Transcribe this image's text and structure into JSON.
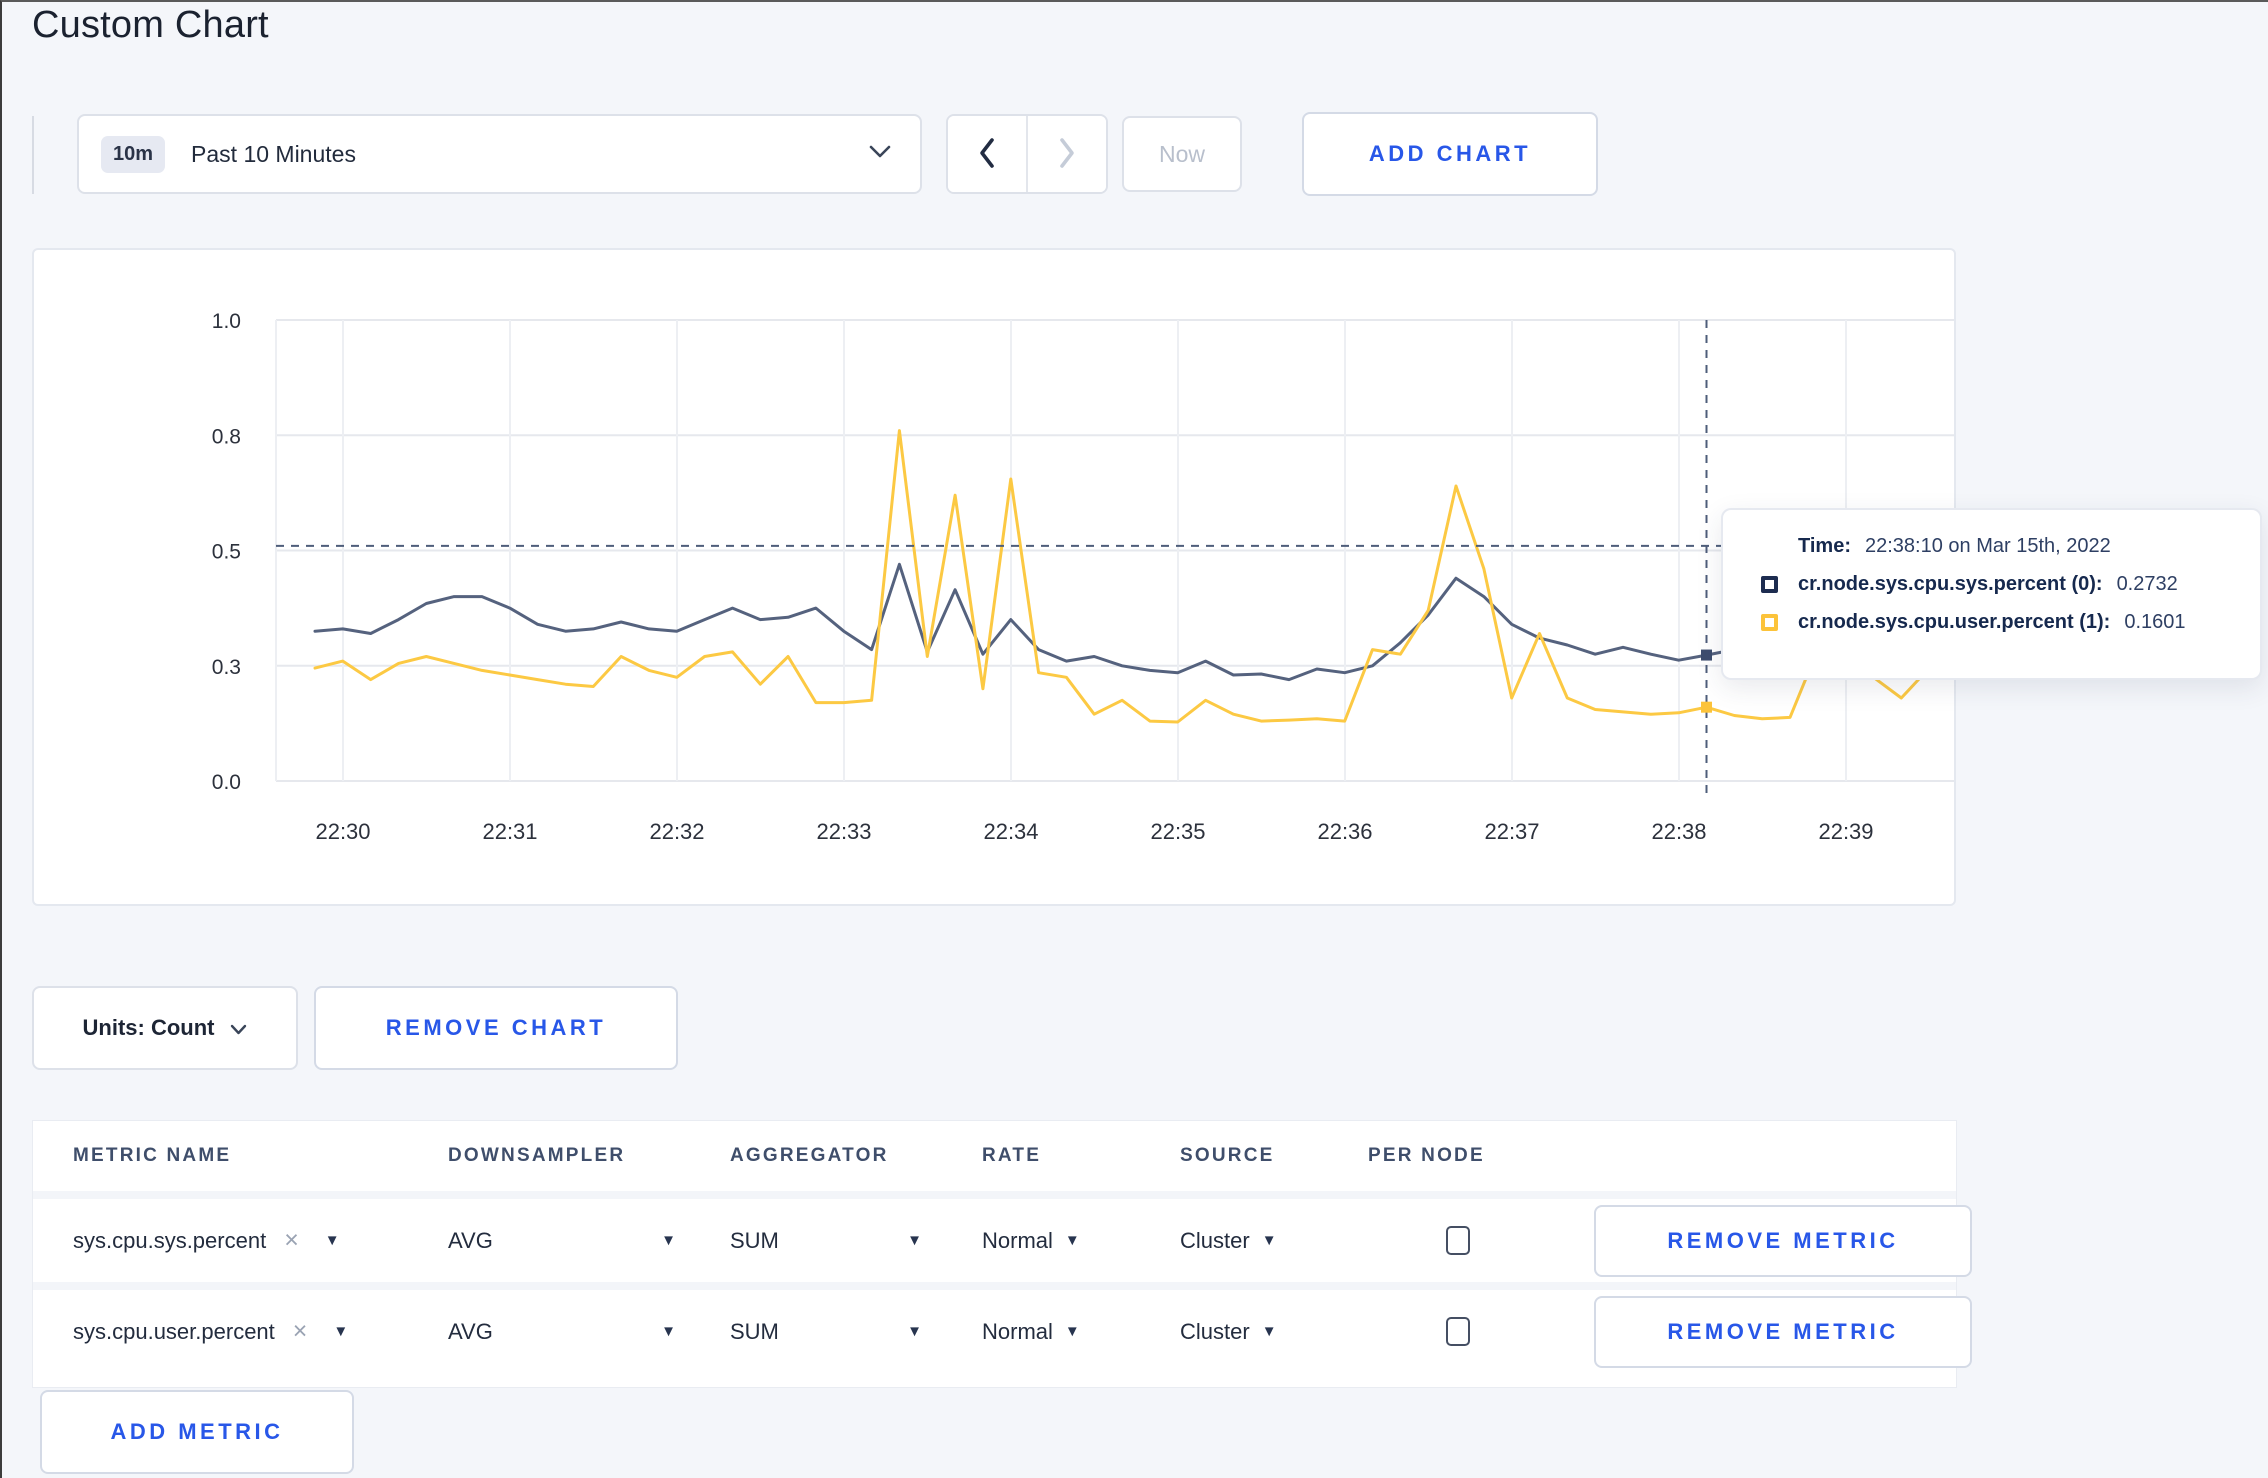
{
  "title": "Custom Chart",
  "toolbar": {
    "range_badge": "10m",
    "range_label": "Past 10 Minutes",
    "now_label": "Now",
    "add_chart_label": "ADD CHART"
  },
  "controls": {
    "units_label": "Units: Count",
    "remove_chart_label": "REMOVE CHART"
  },
  "tooltip": {
    "time_label": "Time:",
    "time_value": "22:38:10 on Mar 15th, 2022",
    "series": [
      {
        "label": "cr.node.sys.cpu.sys.percent (0):",
        "value": "0.2732",
        "color": "#1d2c50"
      },
      {
        "label": "cr.node.sys.cpu.user.percent (1):",
        "value": "0.1601",
        "color": "#fcc33a"
      }
    ]
  },
  "chart_data": {
    "type": "line",
    "title": "",
    "xlabel": "",
    "ylabel": "",
    "ylim": [
      0,
      1
    ],
    "grid": true,
    "x_tick_labels": [
      "22:30",
      "22:31",
      "22:32",
      "22:33",
      "22:34",
      "22:35",
      "22:36",
      "22:37",
      "22:38",
      "22:39"
    ],
    "y_ticks": [
      {
        "value": 0,
        "label": "0.0"
      },
      {
        "value": 0.25,
        "label": "0.3"
      },
      {
        "value": 0.5,
        "label": "0.5"
      },
      {
        "value": 0.75,
        "label": "0.8"
      },
      {
        "value": 1.0,
        "label": "1.0"
      }
    ],
    "times": [
      "22:29:50",
      "22:30:00",
      "22:30:10",
      "22:30:20",
      "22:30:30",
      "22:30:40",
      "22:30:50",
      "22:31:00",
      "22:31:10",
      "22:31:20",
      "22:31:30",
      "22:31:40",
      "22:31:50",
      "22:32:00",
      "22:32:10",
      "22:32:20",
      "22:32:30",
      "22:32:40",
      "22:32:50",
      "22:33:00",
      "22:33:10",
      "22:33:20",
      "22:33:30",
      "22:33:40",
      "22:33:50",
      "22:34:00",
      "22:34:10",
      "22:34:20",
      "22:34:30",
      "22:34:40",
      "22:34:50",
      "22:35:00",
      "22:35:10",
      "22:35:20",
      "22:35:30",
      "22:35:40",
      "22:35:50",
      "22:36:00",
      "22:36:10",
      "22:36:20",
      "22:36:30",
      "22:36:40",
      "22:36:50",
      "22:37:00",
      "22:37:10",
      "22:37:20",
      "22:37:30",
      "22:37:40",
      "22:37:50",
      "22:38:00",
      "22:38:10",
      "22:38:20",
      "22:38:30",
      "22:38:40",
      "22:38:50",
      "22:39:00",
      "22:39:10",
      "22:39:20",
      "22:39:30"
    ],
    "series": [
      {
        "name": "cr.node.sys.cpu.sys.percent (0)",
        "color": "#55627e",
        "values": [
          0.325,
          0.33,
          0.32,
          0.35,
          0.385,
          0.4,
          0.4,
          0.375,
          0.34,
          0.325,
          0.33,
          0.345,
          0.33,
          0.325,
          0.35,
          0.375,
          0.35,
          0.355,
          0.375,
          0.325,
          0.285,
          0.47,
          0.28,
          0.415,
          0.275,
          0.35,
          0.285,
          0.26,
          0.27,
          0.25,
          0.24,
          0.235,
          0.26,
          0.23,
          0.232,
          0.22,
          0.243,
          0.235,
          0.25,
          0.3,
          0.36,
          0.44,
          0.4,
          0.34,
          0.31,
          0.295,
          0.275,
          0.29,
          0.275,
          0.262,
          0.2732,
          0.285,
          0.275,
          0.28,
          0.3,
          0.285,
          0.28,
          0.285,
          0.29
        ]
      },
      {
        "name": "cr.node.sys.cpu.user.percent (1)",
        "color": "#fcc943",
        "values": [
          0.245,
          0.26,
          0.22,
          0.255,
          0.27,
          0.255,
          0.24,
          0.23,
          0.22,
          0.21,
          0.205,
          0.27,
          0.24,
          0.225,
          0.27,
          0.28,
          0.21,
          0.27,
          0.17,
          0.17,
          0.175,
          0.76,
          0.27,
          0.62,
          0.2,
          0.655,
          0.235,
          0.225,
          0.145,
          0.175,
          0.13,
          0.128,
          0.175,
          0.145,
          0.13,
          0.132,
          0.135,
          0.13,
          0.285,
          0.275,
          0.37,
          0.64,
          0.46,
          0.18,
          0.32,
          0.18,
          0.155,
          0.15,
          0.145,
          0.148,
          0.1601,
          0.142,
          0.135,
          0.138,
          0.285,
          0.28,
          0.225,
          0.18,
          0.245
        ]
      }
    ],
    "crosshair": {
      "time": "22:38:10",
      "index": 50,
      "h_line_value": 0.51
    }
  },
  "metrics_table": {
    "headers": [
      "METRIC NAME",
      "DOWNSAMPLER",
      "AGGREGATOR",
      "RATE",
      "SOURCE",
      "PER NODE"
    ],
    "rows": [
      {
        "metric_name": "sys.cpu.sys.percent",
        "downsampler": "AVG",
        "aggregator": "SUM",
        "rate": "Normal",
        "source": "Cluster",
        "per_node_checked": false,
        "remove_label": "REMOVE METRIC"
      },
      {
        "metric_name": "sys.cpu.user.percent",
        "downsampler": "AVG",
        "aggregator": "SUM",
        "rate": "Normal",
        "source": "Cluster",
        "per_node_checked": false,
        "remove_label": "REMOVE METRIC"
      }
    ],
    "add_metric_label": "ADD METRIC"
  },
  "colors": {
    "accent_blue": "#2857e8",
    "line_sys": "#55627e",
    "line_user": "#fcc943",
    "page_bg": "#f4f6fa"
  }
}
